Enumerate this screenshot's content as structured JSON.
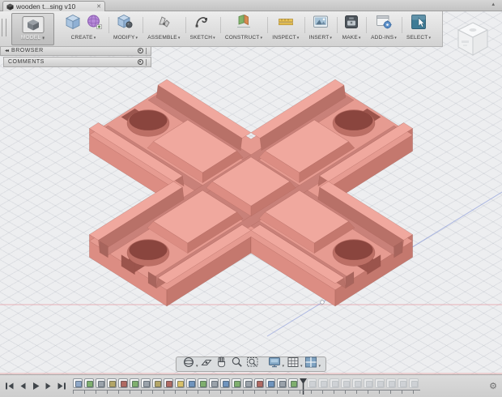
{
  "window": {
    "tab_title": "wooden t...sing v10",
    "close_glyph": "✕",
    "collapse_glyph": "▴"
  },
  "toolbar": {
    "caret": "▾",
    "model": {
      "label": "MODEL"
    },
    "items": [
      {
        "id": "create",
        "label": "CREATE",
        "icons": [
          "solid-cube-icon",
          "form-sphere-icon"
        ]
      },
      {
        "id": "modify",
        "label": "MODIFY",
        "icons": [
          "press-pull-icon"
        ]
      },
      {
        "id": "assemble",
        "label": "ASSEMBLE",
        "icons": [
          "joint-icon"
        ]
      },
      {
        "id": "sketch",
        "label": "SKETCH",
        "icons": [
          "spline-icon"
        ]
      },
      {
        "id": "construct",
        "label": "CONSTRUCT",
        "icons": [
          "construction-plane-icon"
        ]
      },
      {
        "id": "inspect",
        "label": "INSPECT",
        "icons": [
          "measure-icon"
        ]
      },
      {
        "id": "insert",
        "label": "INSERT",
        "icons": [
          "insert-image-icon"
        ]
      },
      {
        "id": "make",
        "label": "MAKE",
        "icons": [
          "3d-print-icon"
        ]
      },
      {
        "id": "addins",
        "label": "ADD-INS",
        "icons": [
          "addins-gear-icon"
        ]
      },
      {
        "id": "select",
        "label": "SELECT",
        "icons": [
          "select-cursor-icon"
        ]
      }
    ]
  },
  "panels": {
    "browser": {
      "label": "BROWSER",
      "collapse_glyph": "◂◂"
    },
    "comments": {
      "label": "COMMENTS"
    }
  },
  "navbar": {
    "buttons": [
      {
        "id": "orbit",
        "dropdown": true
      },
      {
        "id": "look-at",
        "dropdown": false
      },
      {
        "id": "pan",
        "dropdown": false
      },
      {
        "id": "zoom",
        "dropdown": false
      },
      {
        "id": "fit-zoom-window",
        "dropdown": false
      },
      {
        "id": "display-settings",
        "dropdown": true
      },
      {
        "id": "grid-layout",
        "dropdown": true
      },
      {
        "id": "viewports",
        "dropdown": true
      }
    ]
  },
  "timeline": {
    "playback": [
      "go-to-start",
      "step-back",
      "play",
      "step-forward",
      "go-to-end"
    ],
    "gear_glyph": "⚙",
    "features": [
      {
        "state": "active",
        "color": "#8FA8C8"
      },
      {
        "state": "active",
        "color": "#7FAF6E"
      },
      {
        "state": "active",
        "color": "#9AA2AA"
      },
      {
        "state": "active",
        "color": "#B3A567"
      },
      {
        "state": "active",
        "color": "#B06A62"
      },
      {
        "state": "active",
        "color": "#7FAF6E"
      },
      {
        "state": "active",
        "color": "#9AA2AA"
      },
      {
        "state": "active",
        "color": "#B3A567"
      },
      {
        "state": "active",
        "color": "#B06A62"
      },
      {
        "state": "active",
        "color": "#D8C06A"
      },
      {
        "state": "active",
        "color": "#6F94BD"
      },
      {
        "state": "active",
        "color": "#7FAF6E"
      },
      {
        "state": "active",
        "color": "#9AA2AA"
      },
      {
        "state": "active",
        "color": "#6F94BD"
      },
      {
        "state": "active",
        "color": "#7FAF6E"
      },
      {
        "state": "active",
        "color": "#9AA2AA"
      },
      {
        "state": "active",
        "color": "#B06A62"
      },
      {
        "state": "active",
        "color": "#6F94BD"
      },
      {
        "state": "active",
        "color": "#9AA2AA"
      },
      {
        "state": "active",
        "color": "#7FAF6E"
      },
      {
        "state": "future",
        "color": "#9AA2AA"
      },
      {
        "state": "future",
        "color": "#9AA2AA"
      },
      {
        "state": "future",
        "color": "#9AA2AA"
      },
      {
        "state": "future",
        "color": "#9AA2AA"
      },
      {
        "state": "future",
        "color": "#9AA2AA"
      },
      {
        "state": "future",
        "color": "#9AA2AA"
      },
      {
        "state": "future",
        "color": "#9AA2AA"
      },
      {
        "state": "future",
        "color": "#9AA2AA"
      },
      {
        "state": "future",
        "color": "#9AA2AA"
      },
      {
        "state": "future",
        "color": "#9AA2AA"
      }
    ]
  },
  "colors": {
    "select_accent": "#3E7B96",
    "model": {
      "top": "#F0A89E",
      "top_light": "#F6B5AB",
      "top_light2": "#F3AFA5",
      "bed": "#E69B91",
      "groove": "#C98179",
      "wall_mid": "#DC8D83",
      "wall_dark": "#C4786E",
      "chamfer_dark": "#B87168",
      "notch": "#A8655D",
      "slot": "#9B544C",
      "hole_lit": "#BC6F65",
      "hole_deep": "#8A453E",
      "edge": "rgba(145,75,68,0.45)",
      "axis_red": "rgba(225,130,140,0.55)",
      "axis_blue": "rgba(120,140,215,0.55)"
    }
  }
}
